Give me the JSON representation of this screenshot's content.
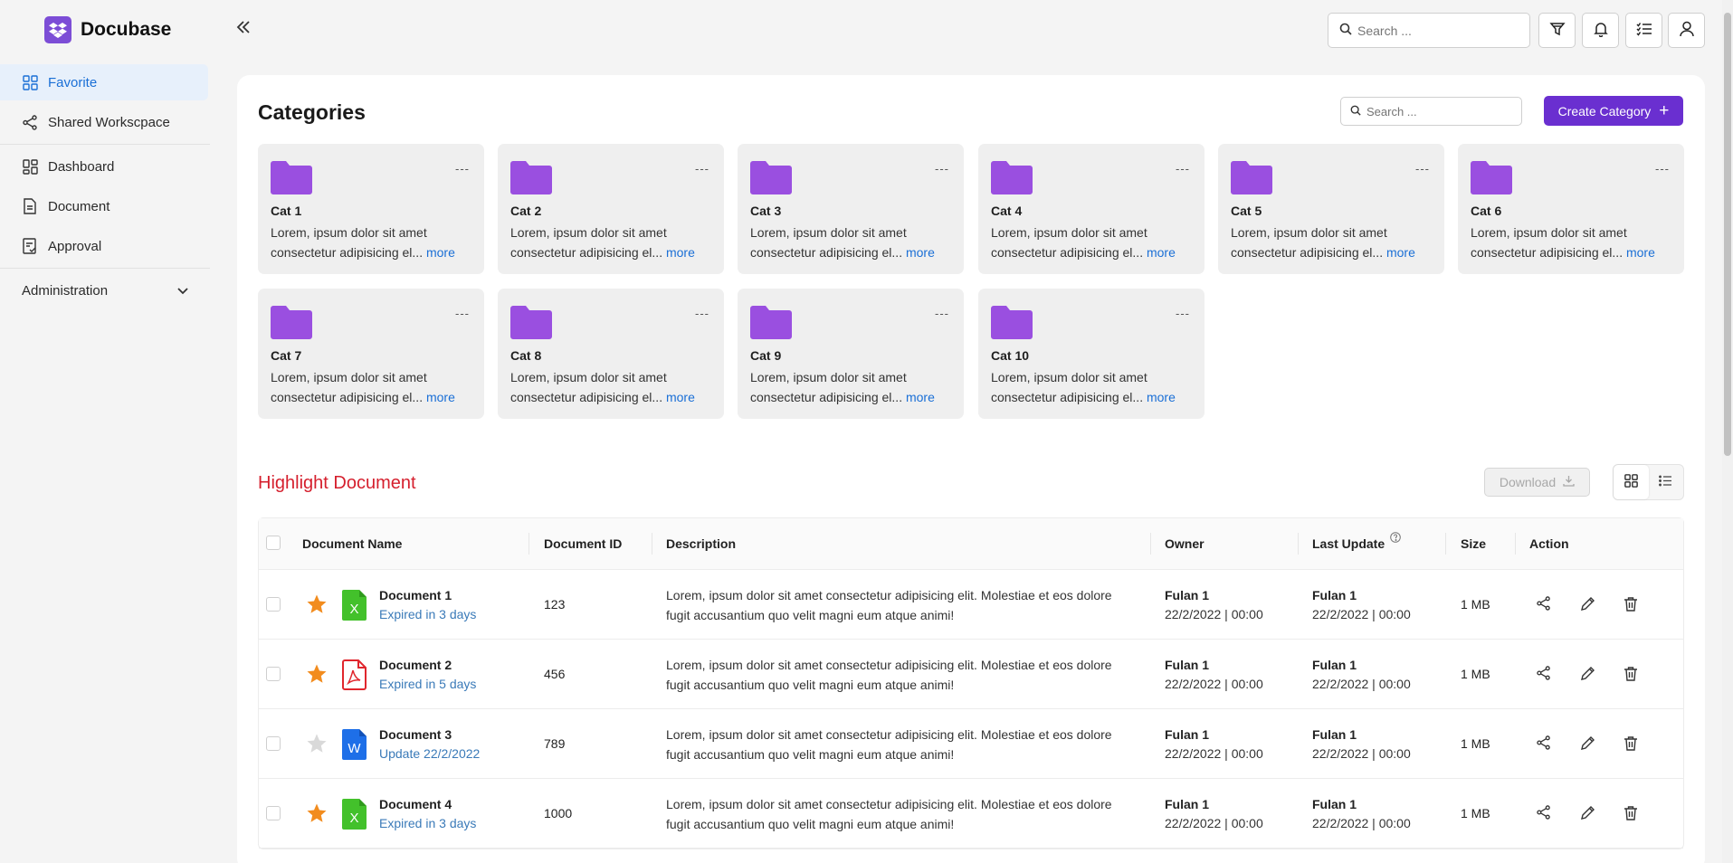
{
  "app": {
    "name": "Docubase",
    "brand_color": "#7c4dd6",
    "accent_color": "#6a2fd0"
  },
  "sidebar": {
    "items": [
      {
        "label": "Favorite",
        "icon": "grid-icon",
        "active": true
      },
      {
        "label": "Shared Workscpace",
        "icon": "share-icon"
      },
      {
        "label": "Dashboard",
        "icon": "dashboard-icon"
      },
      {
        "label": "Document",
        "icon": "document-icon"
      },
      {
        "label": "Approval",
        "icon": "approval-icon"
      }
    ],
    "admin": {
      "label": "Administration",
      "icon": "chevron-down-icon"
    }
  },
  "topbar": {
    "search_placeholder": "Search ..."
  },
  "categories": {
    "title": "Categories",
    "search_placeholder": "Search ...",
    "create_label": "Create Category",
    "more_label": "more",
    "menu_label": "---",
    "items": [
      {
        "name": "Cat 1",
        "desc_line1": "Lorem, ipsum dolor sit amet",
        "desc_line2": "consectetur adipisicing el..."
      },
      {
        "name": "Cat 2",
        "desc_line1": "Lorem, ipsum dolor sit amet",
        "desc_line2": "consectetur adipisicing el..."
      },
      {
        "name": "Cat 3",
        "desc_line1": "Lorem, ipsum dolor sit amet",
        "desc_line2": "consectetur adipisicing el..."
      },
      {
        "name": "Cat 4",
        "desc_line1": "Lorem, ipsum dolor sit amet",
        "desc_line2": "consectetur adipisicing el..."
      },
      {
        "name": "Cat 5",
        "desc_line1": "Lorem, ipsum dolor sit amet",
        "desc_line2": "consectetur adipisicing el..."
      },
      {
        "name": "Cat 6",
        "desc_line1": "Lorem, ipsum dolor sit amet",
        "desc_line2": "consectetur adipisicing el..."
      },
      {
        "name": "Cat 7",
        "desc_line1": "Lorem, ipsum dolor sit amet",
        "desc_line2": "consectetur adipisicing el..."
      },
      {
        "name": "Cat 8",
        "desc_line1": "Lorem, ipsum dolor sit amet",
        "desc_line2": "consectetur adipisicing el..."
      },
      {
        "name": "Cat 9",
        "desc_line1": "Lorem, ipsum dolor sit amet",
        "desc_line2": "consectetur adipisicing el..."
      },
      {
        "name": "Cat 10",
        "desc_line1": "Lorem, ipsum dolor sit amet",
        "desc_line2": "consectetur adipisicing el..."
      }
    ]
  },
  "highlight": {
    "title": "Highlight Document",
    "download_label": "Download",
    "columns": {
      "name": "Document Name",
      "id": "Document ID",
      "description": "Description",
      "owner": "Owner",
      "last_update": "Last Update",
      "size": "Size",
      "action": "Action"
    },
    "rows": [
      {
        "name": "Document 1",
        "sub": "Expired in 3 days",
        "starred": true,
        "file_type": "excel",
        "file_letter": "X",
        "id": "123",
        "desc_line1": "Lorem, ipsum dolor sit amet consectetur adipisicing elit. Molestiae et eos dolore",
        "desc_line2": "fugit accusantium quo velit magni eum atque animi!",
        "owner_name": "Fulan 1",
        "owner_date": "22/2/2022 | 00:00",
        "update_name": "Fulan 1",
        "update_date": "22/2/2022 | 00:00",
        "size": "1 MB"
      },
      {
        "name": "Document 2",
        "sub": "Expired in 5 days",
        "starred": true,
        "file_type": "pdf",
        "file_letter": "",
        "id": "456",
        "desc_line1": "Lorem, ipsum dolor sit amet consectetur adipisicing elit. Molestiae et eos dolore",
        "desc_line2": "fugit accusantium quo velit magni eum atque animi!",
        "owner_name": "Fulan 1",
        "owner_date": "22/2/2022 | 00:00",
        "update_name": "Fulan 1",
        "update_date": "22/2/2022 | 00:00",
        "size": "1 MB"
      },
      {
        "name": "Document 3",
        "sub": "Update 22/2/2022",
        "starred": false,
        "file_type": "word",
        "file_letter": "W",
        "id": "789",
        "desc_line1": "Lorem, ipsum dolor sit amet consectetur adipisicing elit. Molestiae et eos dolore",
        "desc_line2": "fugit accusantium quo velit magni eum atque animi!",
        "owner_name": "Fulan 1",
        "owner_date": "22/2/2022 | 00:00",
        "update_name": "Fulan 1",
        "update_date": "22/2/2022 | 00:00",
        "size": "1 MB"
      },
      {
        "name": "Document 4",
        "sub": "Expired in 3 days",
        "starred": true,
        "file_type": "excel",
        "file_letter": "X",
        "id": "1000",
        "desc_line1": "Lorem, ipsum dolor sit amet consectetur adipisicing elit. Molestiae et eos dolore",
        "desc_line2": "fugit accusantium quo velit magni eum atque animi!",
        "owner_name": "Fulan 1",
        "owner_date": "22/2/2022 | 00:00",
        "update_name": "Fulan 1",
        "update_date": "22/2/2022 | 00:00",
        "size": "1 MB"
      }
    ]
  }
}
